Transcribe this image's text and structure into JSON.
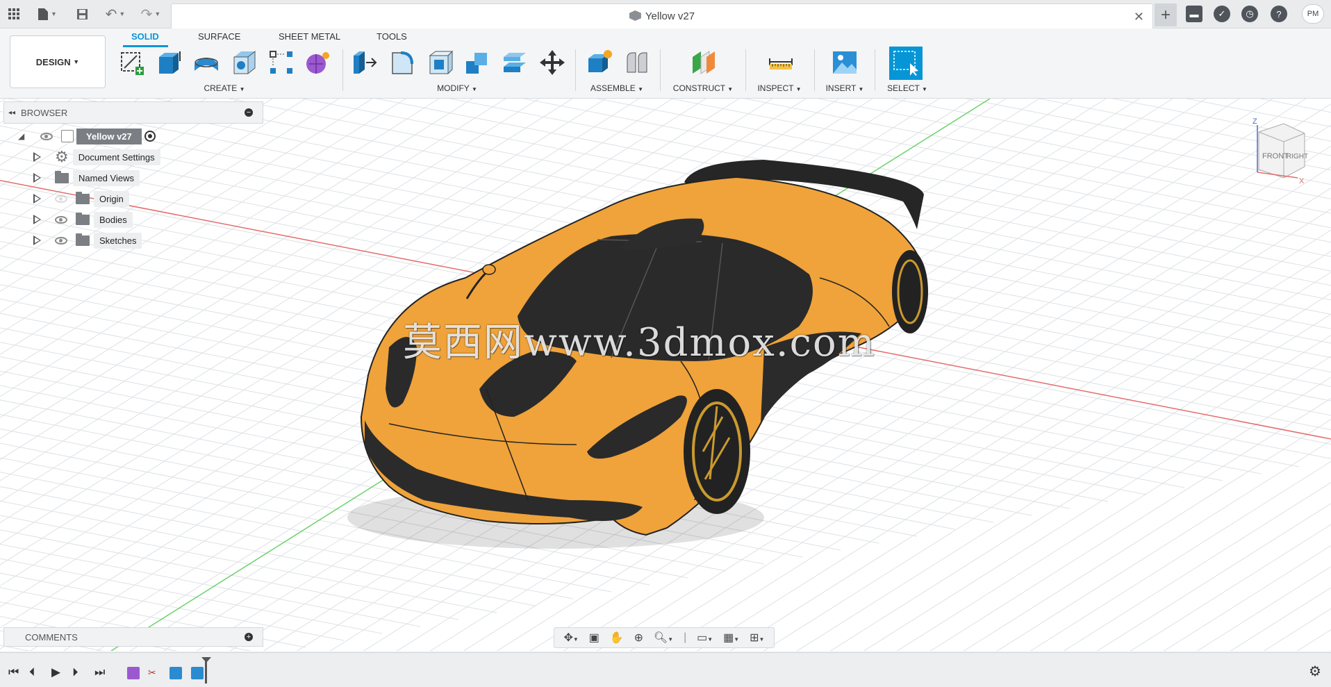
{
  "document": {
    "title": "Yellow v27",
    "user_initials": "PM"
  },
  "workspace": {
    "mode_label": "DESIGN"
  },
  "toolbar_tabs": [
    {
      "label": "SOLID",
      "active": true
    },
    {
      "label": "SURFACE"
    },
    {
      "label": "SHEET METAL"
    },
    {
      "label": "TOOLS"
    }
  ],
  "toolbar_groups": {
    "create": "CREATE",
    "modify": "MODIFY",
    "assemble": "ASSEMBLE",
    "construct": "CONSTRUCT",
    "inspect": "INSPECT",
    "insert": "INSERT",
    "select": "SELECT"
  },
  "browser": {
    "title": "BROWSER",
    "root": "Yellow v27",
    "items": [
      {
        "label": "Document Settings",
        "icon": "gear-icon"
      },
      {
        "label": "Named Views",
        "icon": "folder-icon"
      },
      {
        "label": "Origin",
        "icon": "folder-icon",
        "visible": false
      },
      {
        "label": "Bodies",
        "icon": "folder-icon",
        "visible": true
      },
      {
        "label": "Sketches",
        "icon": "folder-icon",
        "visible": true
      }
    ]
  },
  "comments": {
    "title": "COMMENTS"
  },
  "viewcube": {
    "front": "FRONT",
    "right": "RIGHT",
    "axis_z": "Z",
    "axis_x": "X"
  },
  "watermark": "莫西网www.3dmox.com",
  "colors": {
    "accent": "#0696d7",
    "car_body": "#f0a33a",
    "car_dark": "#2a2a2a",
    "grid": "#d9dde2"
  }
}
